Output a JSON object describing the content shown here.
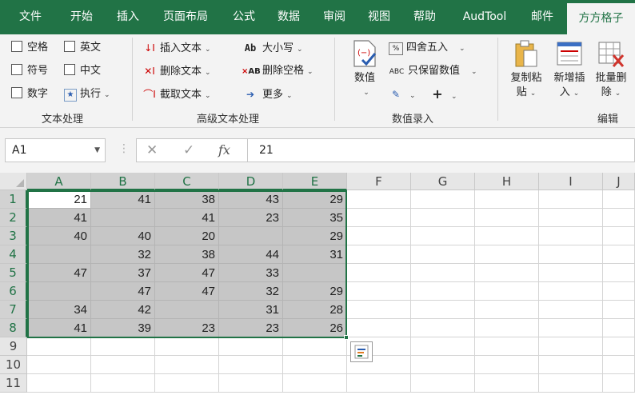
{
  "tabs": [
    "文件",
    "开始",
    "插入",
    "页面布局",
    "公式",
    "数据",
    "审阅",
    "视图",
    "帮助",
    "AudTool",
    "邮件",
    "方方格子"
  ],
  "active_tab_index": 11,
  "groups": {
    "text_processing": {
      "label": "文本处理",
      "checkboxes": [
        "空格",
        "英文",
        "符号",
        "中文",
        "数字"
      ],
      "execute": "执行"
    },
    "advanced_text": {
      "label": "高级文本处理",
      "buttons": [
        "插入文本",
        "删除文本",
        "截取文本",
        "大小写",
        "删除空格",
        "更多"
      ]
    },
    "number_entry": {
      "label": "数值录入",
      "big_button": "数值",
      "buttons": [
        "四舍五入",
        "只保留数值"
      ]
    },
    "edit": {
      "label": "编辑",
      "big_buttons": [
        {
          "line1": "复制粘",
          "line2": "贴"
        },
        {
          "line1": "新增插",
          "line2": "入"
        },
        {
          "line1": "批量删",
          "line2": "除"
        }
      ]
    }
  },
  "formula_bar": {
    "name_box": "A1",
    "fx_label": "fx",
    "value": "21"
  },
  "columns": [
    "A",
    "B",
    "C",
    "D",
    "E",
    "F",
    "G",
    "H",
    "I",
    "J"
  ],
  "rows": [
    "1",
    "2",
    "3",
    "4",
    "5",
    "6",
    "7",
    "8",
    "9",
    "10",
    "11"
  ],
  "cells": [
    [
      "21",
      "41",
      "38",
      "43",
      "29"
    ],
    [
      "41",
      "",
      "41",
      "23",
      "35"
    ],
    [
      "40",
      "40",
      "20",
      "",
      "29"
    ],
    [
      "",
      "32",
      "38",
      "44",
      "31"
    ],
    [
      "47",
      "37",
      "47",
      "33",
      ""
    ],
    [
      "",
      "47",
      "47",
      "32",
      "29"
    ],
    [
      "34",
      "42",
      "",
      "31",
      "28"
    ],
    [
      "41",
      "39",
      "23",
      "23",
      "26"
    ]
  ],
  "colors": {
    "accent": "#217346",
    "selection_fill": "#c6c6c6"
  }
}
